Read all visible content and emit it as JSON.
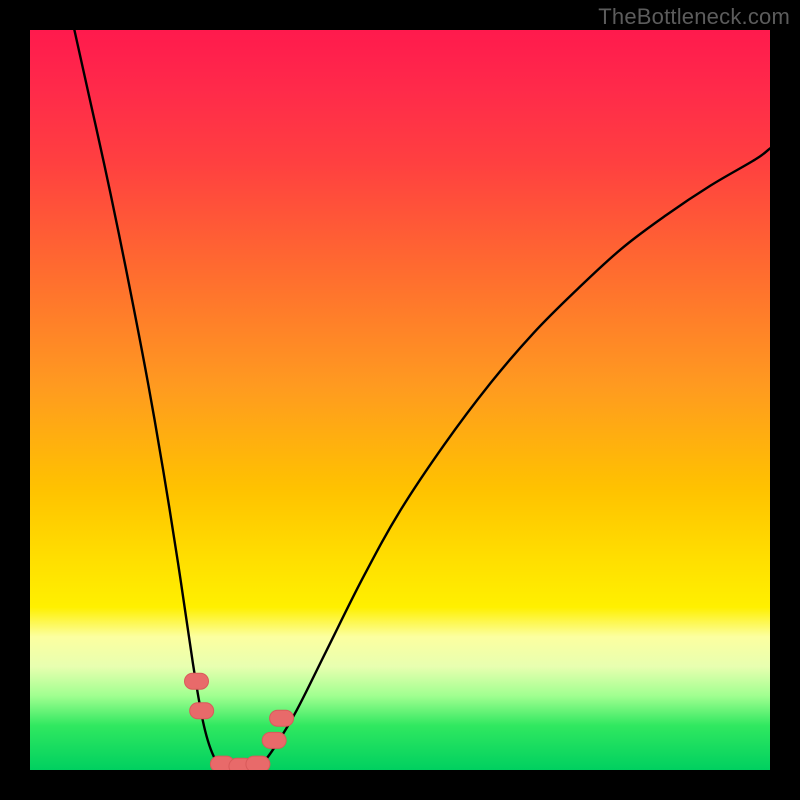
{
  "watermark": "TheBottleneck.com",
  "chart_data": {
    "type": "line",
    "title": "",
    "xlabel": "",
    "ylabel": "",
    "xlim": [
      0,
      100
    ],
    "ylim": [
      0,
      100
    ],
    "grid": false,
    "series": [
      {
        "name": "curve-left",
        "x": [
          6,
          8,
          10,
          12,
          14,
          16,
          18,
          20,
          22,
          23.5,
          25,
          26.5
        ],
        "y": [
          100,
          91,
          82,
          72.5,
          62.5,
          52,
          40.5,
          28,
          14.5,
          6,
          1.5,
          0.3
        ]
      },
      {
        "name": "valley-floor",
        "x": [
          26.5,
          28,
          29.5,
          31
        ],
        "y": [
          0.3,
          0.1,
          0.1,
          0.3
        ]
      },
      {
        "name": "curve-right",
        "x": [
          31,
          33,
          36,
          40,
          45,
          50,
          56,
          62,
          68,
          74,
          80,
          86,
          92,
          98,
          100
        ],
        "y": [
          0.3,
          3,
          8,
          16,
          26,
          35,
          44,
          52,
          59,
          65,
          70.5,
          75,
          79,
          82.5,
          84
        ]
      }
    ],
    "markers": [
      {
        "name": "marker-left-upper",
        "cx": 22.5,
        "cy": 12
      },
      {
        "name": "marker-left-lower",
        "cx": 23.2,
        "cy": 8
      },
      {
        "name": "marker-valley-1",
        "cx": 26.0,
        "cy": 0.8
      },
      {
        "name": "marker-valley-2",
        "cx": 28.5,
        "cy": 0.5
      },
      {
        "name": "marker-valley-3",
        "cx": 30.8,
        "cy": 0.8
      },
      {
        "name": "marker-right-lower",
        "cx": 33.0,
        "cy": 4
      },
      {
        "name": "marker-right-upper",
        "cx": 34.0,
        "cy": 7
      }
    ],
    "colors": {
      "curve": "#000000",
      "marker_fill": "#e86a6a",
      "marker_stroke": "#d95a5a"
    }
  }
}
